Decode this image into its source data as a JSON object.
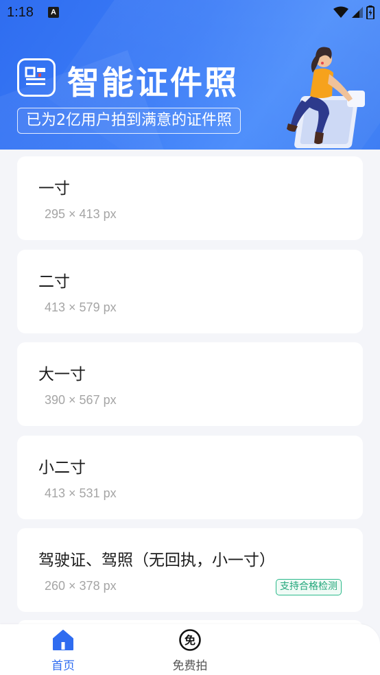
{
  "status_bar": {
    "time": "1:18",
    "notification_icon": "A",
    "icons": [
      "wifi-icon",
      "signal-icon",
      "battery-icon"
    ]
  },
  "banner": {
    "app_title": "智能证件照",
    "slogan": "已为2亿用户拍到满意的证件照",
    "logo_icon": "id-photo-logo-icon",
    "illustration": "woman-sitting-on-phone-illustration"
  },
  "photo_sizes": [
    {
      "name": "一寸",
      "size": "295 × 413 px"
    },
    {
      "name": "二寸",
      "size": "413 × 579 px"
    },
    {
      "name": "大一寸",
      "size": "390 × 567 px"
    },
    {
      "name": "小二寸",
      "size": "413 × 531 px"
    },
    {
      "name": "驾驶证、驾照（无回执，小一寸）",
      "size": "260 × 378 px",
      "badge": "支持合格检测"
    }
  ],
  "tabbar": {
    "home_label": "首页",
    "free_label": "免费拍",
    "home_icon": "home-icon",
    "free_icon": "free-badge-icon",
    "free_icon_glyph": "免"
  },
  "colors": {
    "accent": "#2f6cf0",
    "banner_gradient_start": "#2f6df0",
    "badge_green": "#22a67a"
  }
}
